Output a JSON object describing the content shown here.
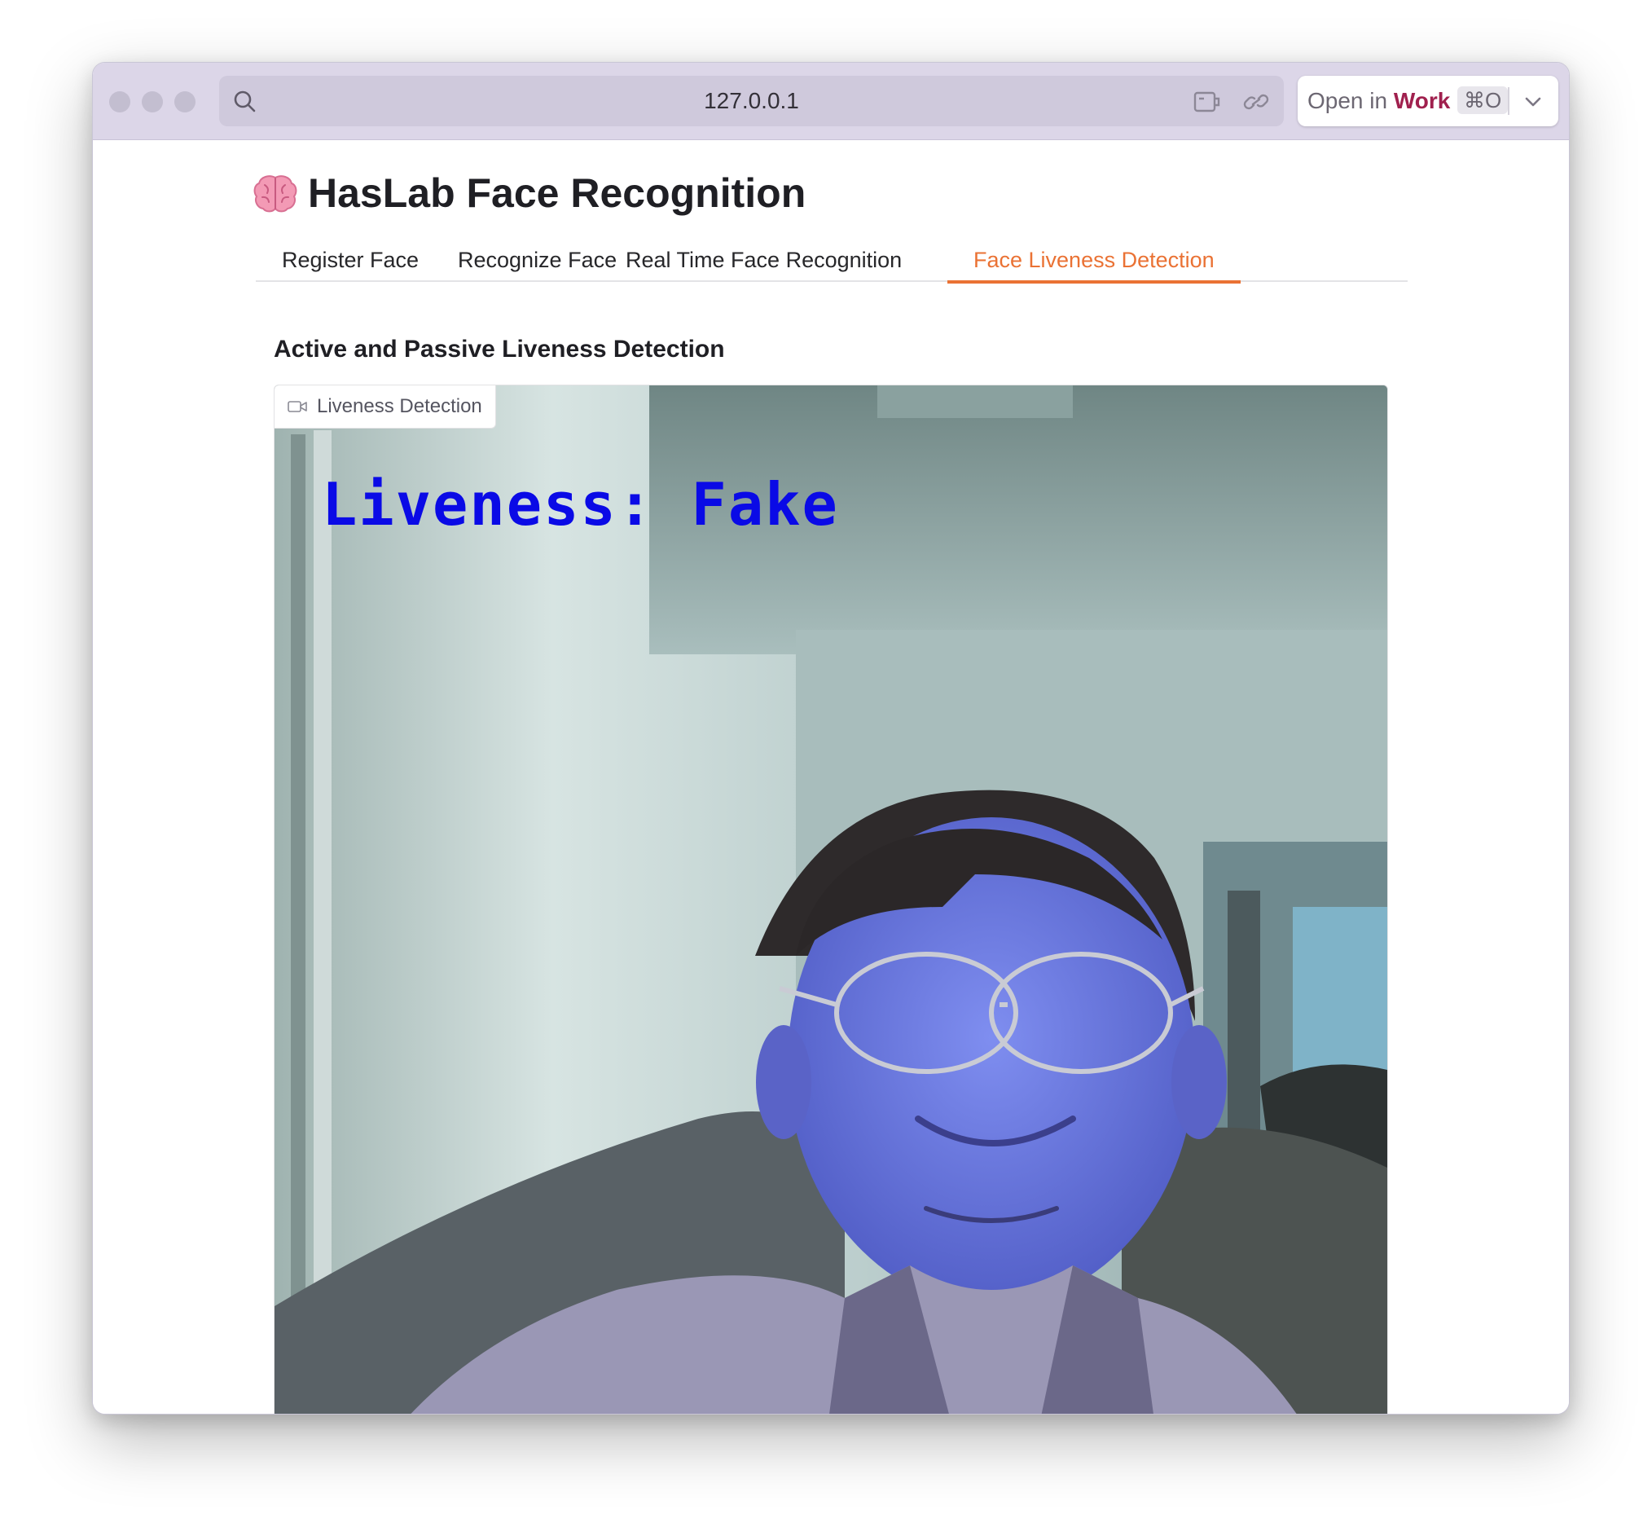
{
  "browser": {
    "url": "127.0.0.1",
    "open_in_prefix": "Open in",
    "open_in_app": "Work",
    "shortcut": "⌘O"
  },
  "app": {
    "title": "HasLab Face Recognition",
    "tabs": [
      {
        "label": "Register Face",
        "active": false
      },
      {
        "label": "Recognize Face",
        "active": false
      },
      {
        "label": "Real Time Face Recognition",
        "active": false
      },
      {
        "label": "Face Liveness Detection",
        "active": true
      }
    ],
    "section_title": "Active and Passive Liveness Detection",
    "video": {
      "label": "Liveness Detection",
      "overlay_text": "Liveness: Fake"
    }
  },
  "colors": {
    "accent": "#ea7234",
    "titlebar": "#dcd6e8",
    "overlay_text": "#0a0ae6",
    "work_brand": "#a0204e"
  },
  "icons": [
    "search-icon",
    "reader-icon",
    "link-icon",
    "chevron-down-icon",
    "brain-icon",
    "camera-icon"
  ]
}
